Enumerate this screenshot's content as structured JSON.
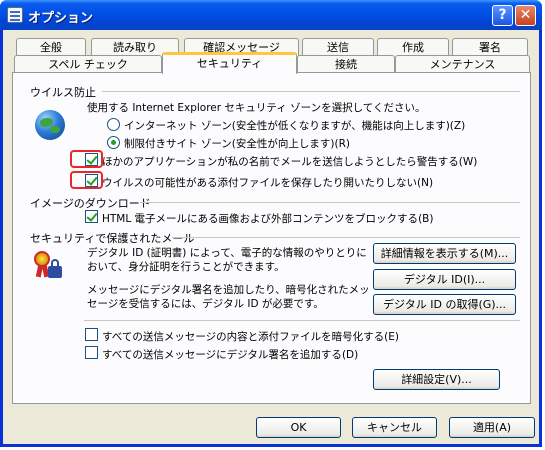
{
  "window": {
    "title": "オプション",
    "help_glyph": "?",
    "close_glyph": "✕"
  },
  "tabs_row1": [
    "全般",
    "読み取り",
    "確認メッセージ",
    "送信",
    "作成",
    "署名"
  ],
  "tabs_row2": [
    "スペル チェック",
    "セキュリティ",
    "接続",
    "メンテナンス"
  ],
  "active_tab": "セキュリティ",
  "virus": {
    "heading": "ウイルス防止",
    "zone_prompt": "使用する Internet Explorer セキュリティ ゾーンを選択してください。",
    "radio_internet": {
      "label": "インターネット ゾーン(安全性が低くなりますが、機能は向上します)",
      "key": "(Z)",
      "checked": false
    },
    "radio_restricted": {
      "label": "制限付きサイト ゾーン(安全性が向上します)",
      "key": "(R)",
      "checked": true
    },
    "check_warn": {
      "label": "ほかのアプリケーションが私の名前でメールを送信しようとしたら警告する",
      "key": "(W)",
      "checked": true
    },
    "check_block_attach": {
      "label": "ウイルスの可能性がある添付ファイルを保存したり開いたりしない",
      "key": "(N)",
      "checked": true
    }
  },
  "image_download": {
    "heading": "イメージのダウンロード",
    "check_block_images": {
      "label": "HTML 電子メールにある画像および外部コンテンツをブロックする",
      "key": "(B)",
      "checked": true
    }
  },
  "secure_mail": {
    "heading": "セキュリティで保護されたメール",
    "desc1_line1": "デジタル ID (証明書) によって、電子的な情報のやりとりに",
    "desc1_line2": "おいて、身分証明を行うことができます。",
    "desc2_line1": "メッセージにデジタル署名を追加したり、暗号化されたメッ",
    "desc2_line2": "セージを受信するには、デジタル ID が必要です。",
    "btn_details": "詳細情報を表示する(M)...",
    "btn_digital_id": "デジタル ID(I)...",
    "btn_get_id": "デジタル ID の取得(G)...",
    "check_encrypt": {
      "label": "すべての送信メッセージの内容と添付ファイルを暗号化する",
      "key": "(E)",
      "checked": false
    },
    "check_sign": {
      "label": "すべての送信メッセージにデジタル署名を追加する",
      "key": "(D)",
      "checked": false
    },
    "btn_advanced": "詳細設定(V)..."
  },
  "footer": {
    "ok": "OK",
    "cancel": "キャンセル",
    "apply": "適用(A)"
  },
  "colors": {
    "titlebar": "#0050e6",
    "highlight": "#e8262b",
    "check": "#21a121"
  }
}
